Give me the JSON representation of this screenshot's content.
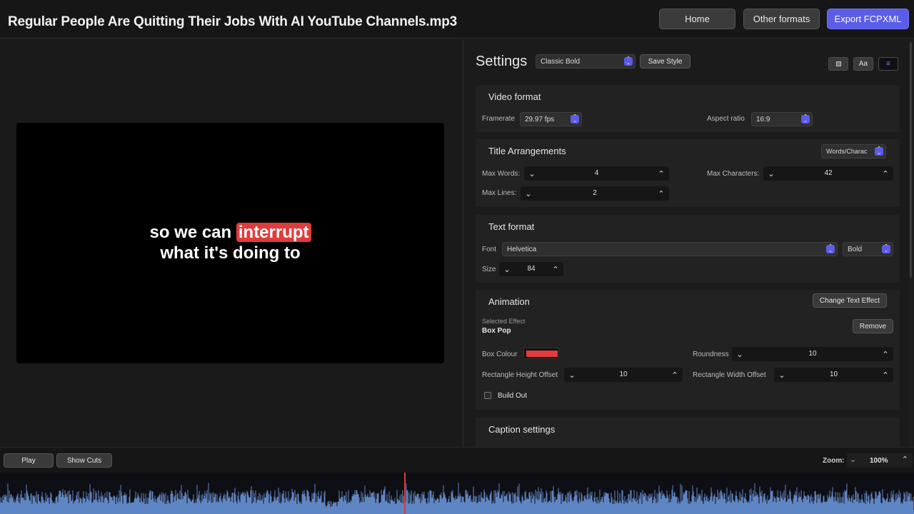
{
  "header": {
    "title": "Regular People Are Quitting Their Jobs With AI YouTube Channels.mp3",
    "home_label": "Home",
    "other_formats_label": "Other formats",
    "export_label": "Export FCPXML"
  },
  "preview": {
    "caption_line1_pre": "so we can ",
    "caption_highlight": "interrupt",
    "caption_line2": "what it's doing to"
  },
  "settings": {
    "title": "Settings",
    "style_select": "Classic Bold",
    "save_style_label": "Save Style",
    "view_buttons": {
      "text_view": "Aa",
      "list_view": "≡"
    },
    "video_format": {
      "heading": "Video format",
      "framerate_label": "Framerate",
      "framerate_value": "29.97 fps",
      "aspect_label": "Aspect ratio",
      "aspect_value": "16:9"
    },
    "title_arrangements": {
      "heading": "Title Arrangements",
      "mode_value": "Words/Charac",
      "max_words_label": "Max Words:",
      "max_words_value": "4",
      "max_chars_label": "Max Characters:",
      "max_chars_value": "42",
      "max_lines_label": "Max Lines:",
      "max_lines_value": "2"
    },
    "text_format": {
      "heading": "Text format",
      "font_label": "Font",
      "font_value": "Helvetica",
      "weight_value": "Bold",
      "size_label": "Size",
      "size_value": "84"
    },
    "animation": {
      "heading": "Animation",
      "change_effect_label": "Change Text Effect",
      "selected_effect_label": "Selected Effect",
      "selected_effect_value": "Box Pop",
      "remove_label": "Remove",
      "box_colour_label": "Box Colour",
      "box_colour_hex": "#e23b3b",
      "roundness_label": "Roundness",
      "roundness_value": "10",
      "rect_height_label": "Rectangle Height Offset",
      "rect_height_value": "10",
      "rect_width_label": "Rectangle Width Offset",
      "rect_width_value": "10",
      "build_out_label": "Build Out"
    },
    "caption_settings": {
      "heading": "Caption settings"
    }
  },
  "bottom": {
    "play_label": "Play",
    "show_cuts_label": "Show Cuts",
    "zoom_label": "Zoom:",
    "zoom_value": "100%"
  },
  "colors": {
    "accent": "#5b5ce8",
    "highlight": "#e23b3b",
    "waveform": "#5f86c4"
  }
}
